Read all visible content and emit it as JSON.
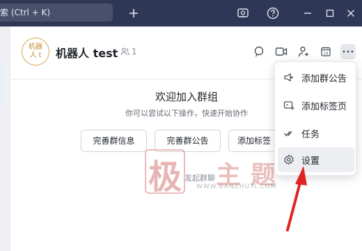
{
  "titlebar": {
    "search_text": "索 (Ctrl + K)"
  },
  "chat": {
    "avatar_line1": "机器",
    "avatar_line2": "人 t",
    "title": "机器人 test",
    "member_count": "1"
  },
  "welcome": {
    "title": "欢迎加入群组",
    "subtitle": "你可以尝试以下操作，快速开始协作",
    "buttons": [
      "完善群信息",
      "完善群公告",
      "添加标签"
    ],
    "start_chat": "发起群聊"
  },
  "menu": {
    "items": [
      {
        "label": "添加群公告",
        "icon": "announcement-add-icon"
      },
      {
        "label": "添加标签页",
        "icon": "tab-add-icon"
      },
      {
        "label": "任务",
        "icon": "task-check-icon"
      },
      {
        "label": "设置",
        "icon": "gear-icon"
      }
    ],
    "active_index": 3
  },
  "watermark": {
    "big_char": "极",
    "small_chars": "主题",
    "url": "WWW.BANZHUTI.COM"
  },
  "colors": {
    "titlebar_bg": "#2f3756",
    "arrow_red": "#e02424",
    "avatar_gold": "#d9a552"
  }
}
